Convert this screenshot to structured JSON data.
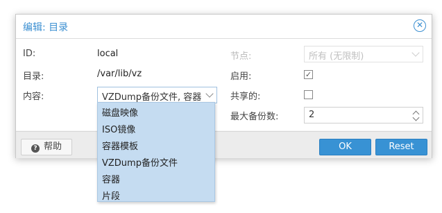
{
  "dialog": {
    "title": "编辑: 目录",
    "close_glyph": "✕"
  },
  "form": {
    "id_label": "ID:",
    "id_value": "local",
    "dir_label": "目录:",
    "dir_value": "/var/lib/vz",
    "content_label": "内容:",
    "content_value": "VZDump备份文件, 容器",
    "node_label": "节点:",
    "node_value": "所有 (无限制)",
    "enable_label": "启用:",
    "enable_checked": true,
    "shared_label": "共享的:",
    "shared_checked": false,
    "maxbackups_label": "最大备份数:",
    "maxbackups_value": "2"
  },
  "dropdown": {
    "items": [
      "磁盘映像",
      "ISO镜像",
      "容器模板",
      "VZDump备份文件",
      "容器",
      "片段"
    ]
  },
  "footer": {
    "help_label": "帮助",
    "help_icon": "?",
    "ok_label": "OK",
    "reset_label": "Reset"
  },
  "colors": {
    "accent": "#3b8fd1",
    "button_primary": "#3892d4",
    "dropdown_bg": "#c5dcf1"
  }
}
